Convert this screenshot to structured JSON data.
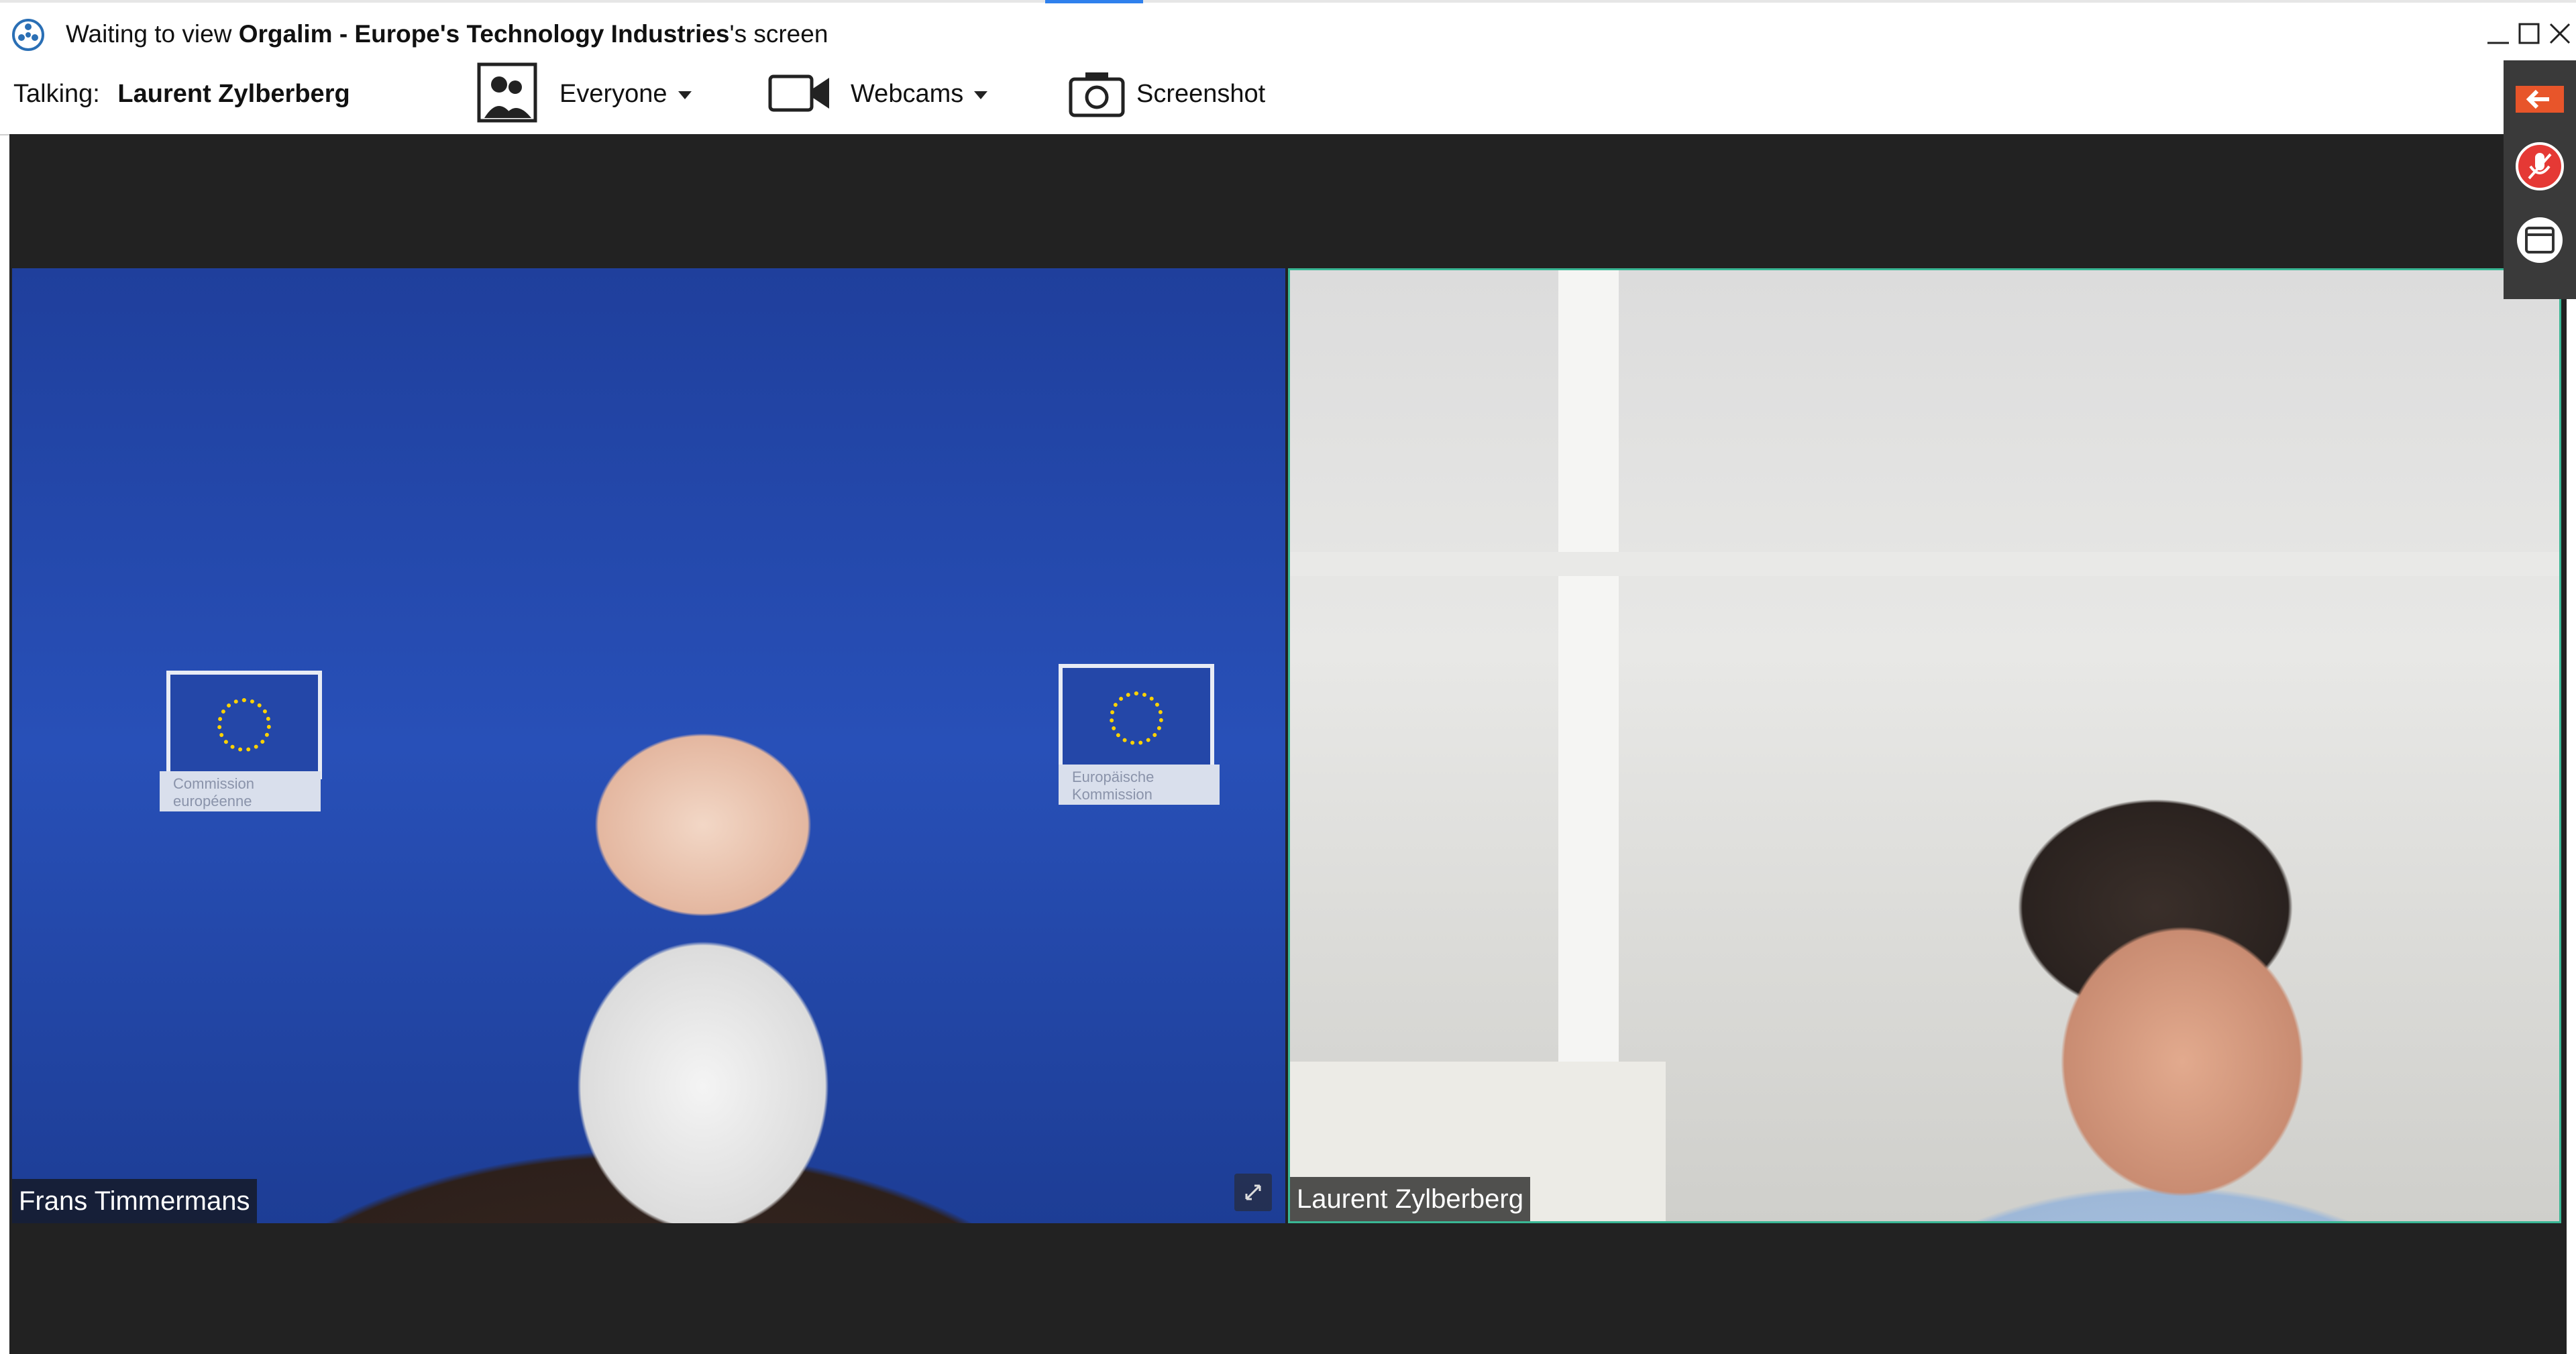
{
  "window": {
    "title_prefix": "Waiting to view ",
    "title_name": "Orgalim - Europe's Technology Industries",
    "title_suffix": "'s screen",
    "buttons": [
      "minimize",
      "maximize",
      "close"
    ]
  },
  "toolbar": {
    "talking_label": "Talking:",
    "talking_name": "Laurent Zylberberg",
    "audience_label": "Everyone",
    "webcams_label": "Webcams",
    "screenshot_label": "Screenshot"
  },
  "participants": [
    {
      "name": "Frans Timmermans",
      "active": false
    },
    {
      "name": "Laurent Zylberberg",
      "active": true
    }
  ],
  "backdrop": {
    "logo_caption_1": "Commission européenne",
    "logo_caption_2": "Europäische Kommission"
  },
  "side_panel": {
    "buttons": [
      "back-arrow",
      "mute-mic",
      "window"
    ]
  },
  "colors": {
    "active_border": "#3ab795",
    "accent_orange": "#e8552a",
    "mic_red": "#e53935",
    "stage_bg": "#222222"
  }
}
